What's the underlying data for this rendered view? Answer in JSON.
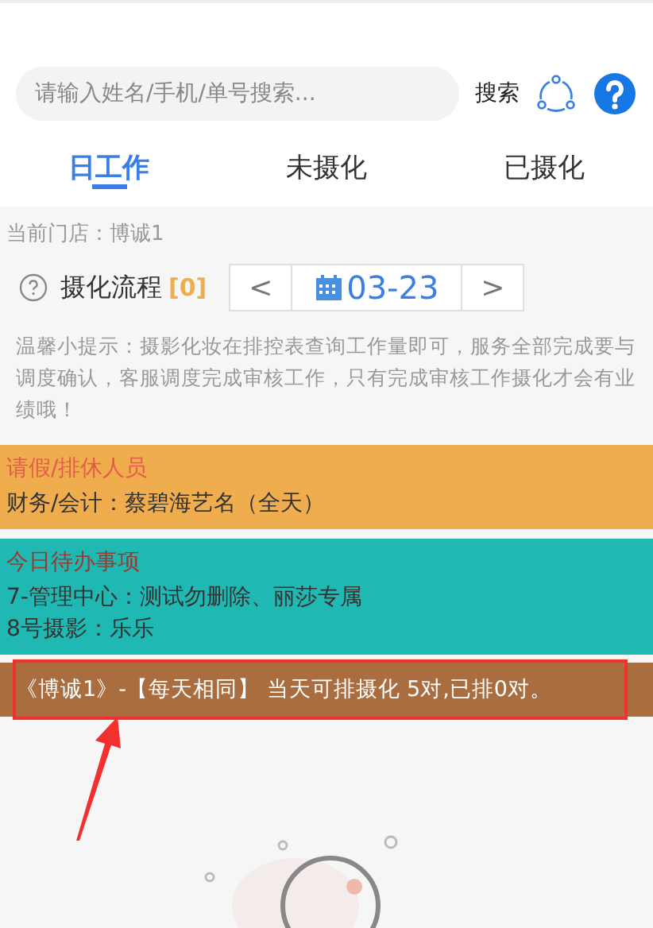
{
  "search": {
    "placeholder": "请输入姓名/手机/单号搜索...",
    "button": "搜索"
  },
  "tabs": [
    {
      "label": "日工作",
      "selected": true
    },
    {
      "label": "未摄化",
      "selected": false
    },
    {
      "label": "已摄化",
      "selected": false
    }
  ],
  "store": "当前门店：博诚1",
  "flow": {
    "title": "摄化流程",
    "count": "[0]",
    "prev": "<",
    "date": "03-23",
    "next": ">"
  },
  "tip": "温馨小提示：摄影化妆在排控表查询工作量即可，服务全部完成要与调度确认，客服调度完成审核工作，只有完成审核工作摄化才会有业绩哦！",
  "panels": [
    {
      "title": "请假/排休人员",
      "lines": [
        "财务/会计：蔡碧海艺名（全天）"
      ],
      "color": "#f0ad4e"
    },
    {
      "title": "今日待办事项",
      "lines": [
        "7-管理中心：测试勿删除、丽莎专属",
        "8号摄影：乐乐"
      ],
      "color": "#1fb8b3"
    }
  ],
  "notice": "《博诚1》-【每天相同】 当天可排摄化 5对,已排0对。"
}
